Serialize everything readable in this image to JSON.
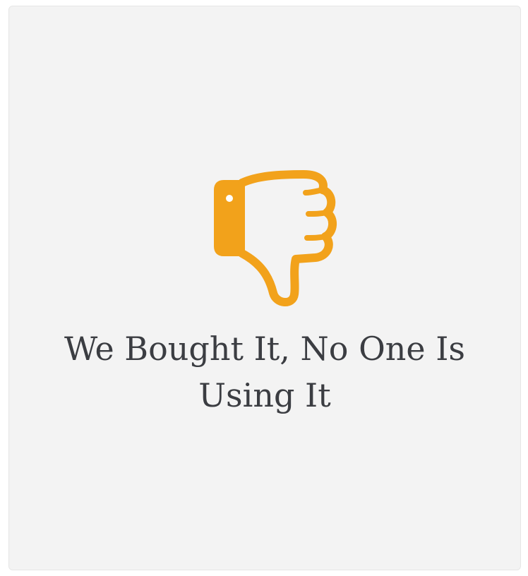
{
  "card": {
    "title_line1": "We Bought It, No One Is",
    "title_line2": "Using It",
    "icon": "thumbs-down-icon",
    "icon_color": "#f2a21b",
    "text_color": "#3b3d42",
    "background_color": "#f3f3f3"
  }
}
